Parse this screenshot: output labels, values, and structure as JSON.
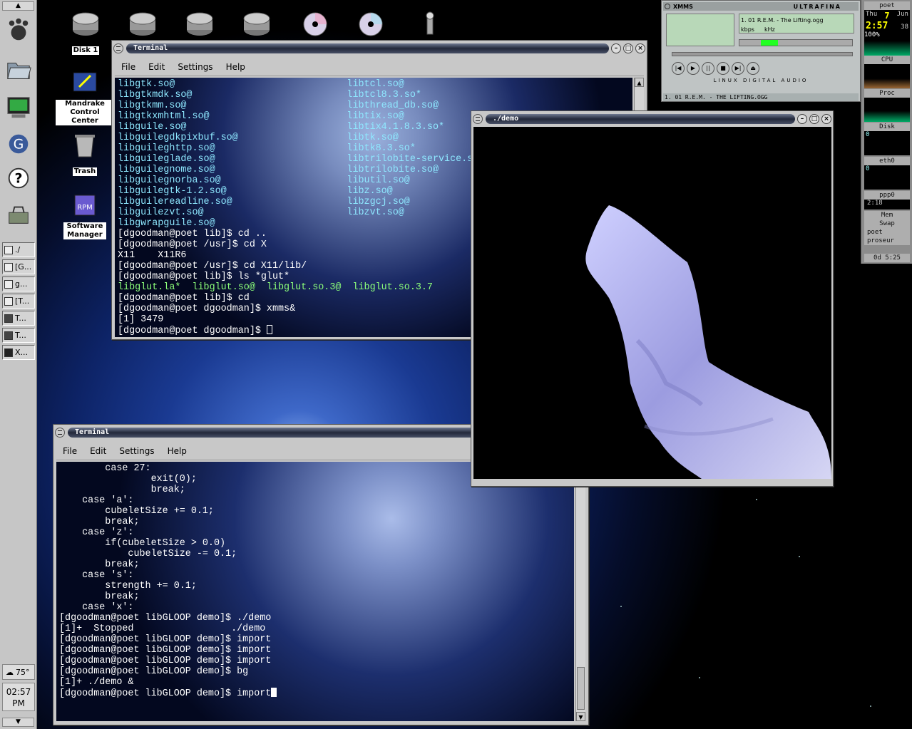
{
  "panel": {
    "tasks": [
      "./",
      "[G...",
      "g...",
      "[T...",
      "T...",
      "T...",
      "X..."
    ],
    "weather": "75°",
    "clock": {
      "time": "02:57",
      "ampm": "PM"
    }
  },
  "desktop_icons": {
    "disk1": "Disk 1",
    "control_center": "Mandrake Control Center",
    "trash": "Trash",
    "software_manager": "Software Manager"
  },
  "top_terminal": {
    "title": "Terminal",
    "menu": [
      "File",
      "Edit",
      "Settings",
      "Help"
    ],
    "lines": [
      "libgtk.so@                              libtcl.so@",
      "libgtkmdk.so@                           libtcl8.3.so*",
      "libgtkmm.so@                            libthread_db.so@",
      "libgtkxmhtml.so@                        libtix.so@",
      "libguile.so@                            libtix4.1.8.3.so*",
      "libguilegdkpixbuf.so@                   libtk.so@",
      "libguileghttp.so@                       libtk8.3.so*",
      "libguileglade.so@                       libtrilobite-service.so",
      "libguilegnome.so@                       libtrilobite.so@",
      "libguilegnorba.so@                      libutil.so@",
      "libguilegtk-1.2.so@                     libz.so@",
      "libguilereadline.so@                    libzgcj.so@",
      "libguilezvt.so@                         libzvt.so@",
      "libgwrapguile.so@",
      "[dgoodman@poet lib]$ cd ..",
      "[dgoodman@poet /usr]$ cd X",
      "X11    X11R6",
      "[dgoodman@poet /usr]$ cd X11/lib/",
      "[dgoodman@poet lib]$ ls *glut*",
      "libglut.la*  libglut.so@  libglut.so.3@  libglut.so.3.7",
      "[dgoodman@poet lib]$ cd",
      "[dgoodman@poet dgoodman]$ xmms&",
      "[1] 3479",
      "[dgoodman@poet dgoodman]$ "
    ]
  },
  "bottom_terminal": {
    "title": "Terminal",
    "menu": [
      "File",
      "Edit",
      "Settings",
      "Help"
    ],
    "lines": [
      "        case 27:",
      "                exit(0);",
      "                break;",
      "    case 'a':",
      "        cubeletSize += 0.1;",
      "        break;",
      "    case 'z':",
      "        if(cubeletSize > 0.0)",
      "            cubeletSize -= 0.1;",
      "        break;",
      "    case 's':",
      "        strength += 0.1;",
      "        break;",
      "    case 'x':",
      "[dgoodman@poet libGLOOP demo]$ ./demo",
      "",
      "[1]+  Stopped                 ./demo",
      "[dgoodman@poet libGLOOP demo]$ import",
      "[dgoodman@poet libGLOOP demo]$ import",
      "[dgoodman@poet libGLOOP demo]$ import",
      "[dgoodman@poet libGLOOP demo]$ bg",
      "[1]+ ./demo &",
      "[dgoodman@poet libGLOOP demo]$ import"
    ]
  },
  "demo_window": {
    "title": "./demo"
  },
  "xmms": {
    "title": "XMMS",
    "skin_name": "ULTRAFINA",
    "song": "1. 01 R.E.M. - The Lifting.ogg",
    "kbps": "kbps",
    "khz": "kHz",
    "footer": "LINUX DIGITAL AUDIO",
    "playlist": "1. 01 R.E.M. - THE LIFTING.OGG"
  },
  "dock": {
    "host": "poet",
    "day": "Thu",
    "date": "7",
    "month": "Jun",
    "clock": "2:57",
    "sec": "38",
    "percent": "100%",
    "cpu": "CPU",
    "proc": "Proc",
    "disk": "Disk",
    "disk_val": "0",
    "eth": "eth0",
    "eth_val": "0",
    "ppp": "ppp0",
    "ppp_time": "2:18",
    "mem": "Mem",
    "swap": "Swap",
    "user1": "poet",
    "user2": "proseur",
    "uptime": "0d 5:25"
  }
}
